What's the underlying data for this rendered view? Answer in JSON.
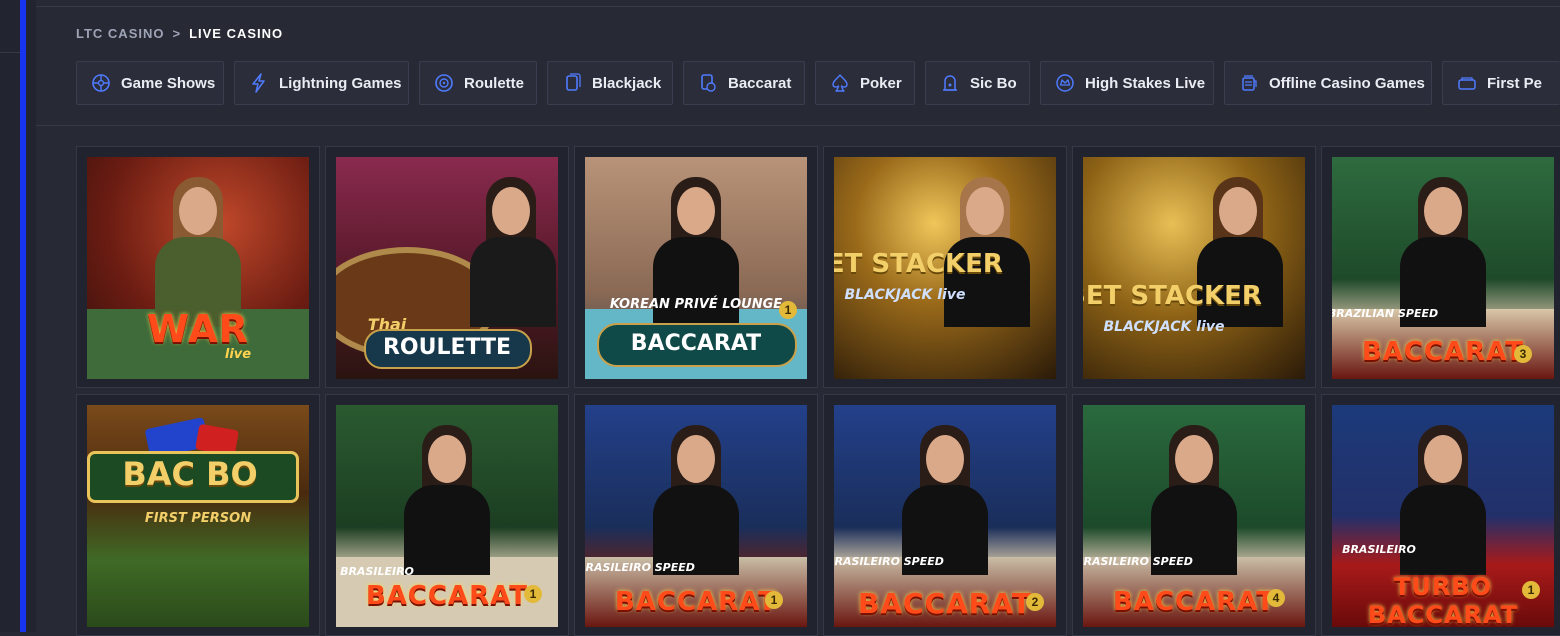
{
  "breadcrumb": {
    "home": "LTC CASINO",
    "separator": ">",
    "current": "LIVE CASINO"
  },
  "categories": [
    {
      "label": "Game Shows",
      "icon": "game-shows-icon"
    },
    {
      "label": "Lightning Games",
      "icon": "lightning-icon"
    },
    {
      "label": "Roulette",
      "icon": "roulette-icon"
    },
    {
      "label": "Blackjack",
      "icon": "blackjack-icon"
    },
    {
      "label": "Baccarat",
      "icon": "baccarat-icon"
    },
    {
      "label": "Poker",
      "icon": "poker-icon"
    },
    {
      "label": "Sic Bo",
      "icon": "sic-bo-icon"
    },
    {
      "label": "High Stakes Live",
      "icon": "high-stakes-icon"
    },
    {
      "label": "Offline Casino Games",
      "icon": "offline-casino-icon"
    },
    {
      "label": "First Pe",
      "icon": "first-person-icon"
    }
  ],
  "games": [
    {
      "logo": "WAR",
      "sub": "live",
      "badge": ""
    },
    {
      "logo": "ROULETTE",
      "sub": "Thai",
      "badge": ""
    },
    {
      "logo": "BACCARAT",
      "sub": "KOREAN PRIVÉ LOUNGE",
      "badge": "1"
    },
    {
      "logo": "BET STACKER",
      "sub": "BLACKJACK live",
      "badge": ""
    },
    {
      "logo": "BET STACKER",
      "sub": "BLACKJACK live",
      "badge": ""
    },
    {
      "logo": "BACCARAT",
      "sub": "BRAZILIAN SPEED",
      "badge": "3"
    },
    {
      "logo": "BAC BO",
      "sub": "FIRST PERSON",
      "badge": ""
    },
    {
      "logo": "BACCARAT",
      "sub": "BRASILEIRO",
      "badge": "1"
    },
    {
      "logo": "BACCARAT",
      "sub": "BRASILEIRO SPEED",
      "badge": "1"
    },
    {
      "logo": "BACCARAT",
      "sub": "BRASILEIRO SPEED",
      "badge": "2"
    },
    {
      "logo": "BACCARAT",
      "sub": "BRASILEIRO SPEED",
      "badge": "4"
    },
    {
      "logo": "TURBO BACCARAT",
      "sub": "BRASILEIRO",
      "badge": "1"
    }
  ]
}
